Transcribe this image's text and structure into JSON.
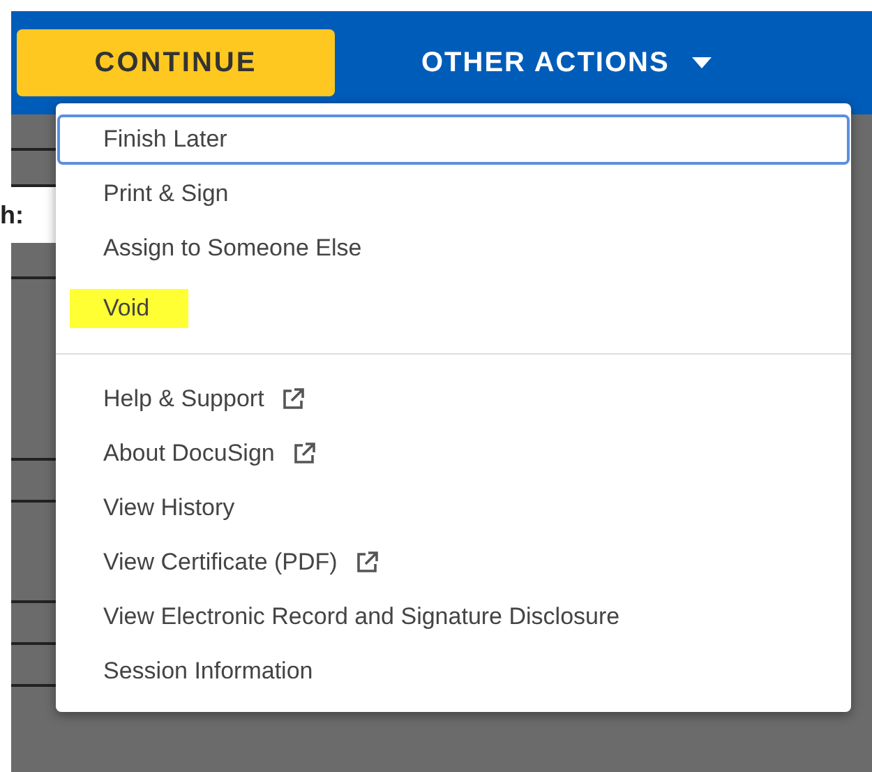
{
  "toolbar": {
    "continue_button": "CONTINUE",
    "other_actions_button": "OTHER ACTIONS"
  },
  "background": {
    "field_label": "h:"
  },
  "menu": {
    "groups": [
      {
        "items": [
          {
            "label": "Finish Later",
            "focused": true,
            "highlighted": false,
            "external": false
          },
          {
            "label": "Print & Sign",
            "focused": false,
            "highlighted": false,
            "external": false
          },
          {
            "label": "Assign to Someone Else",
            "focused": false,
            "highlighted": false,
            "external": false
          },
          {
            "label": "Void",
            "focused": false,
            "highlighted": true,
            "external": false
          }
        ]
      },
      {
        "items": [
          {
            "label": "Help & Support",
            "focused": false,
            "highlighted": false,
            "external": true
          },
          {
            "label": "About DocuSign",
            "focused": false,
            "highlighted": false,
            "external": true
          },
          {
            "label": "View History",
            "focused": false,
            "highlighted": false,
            "external": false
          },
          {
            "label": "View Certificate (PDF)",
            "focused": false,
            "highlighted": false,
            "external": true
          },
          {
            "label": "View Electronic Record and Signature Disclosure",
            "focused": false,
            "highlighted": false,
            "external": false
          },
          {
            "label": "Session Information",
            "focused": false,
            "highlighted": false,
            "external": false
          }
        ]
      }
    ]
  }
}
